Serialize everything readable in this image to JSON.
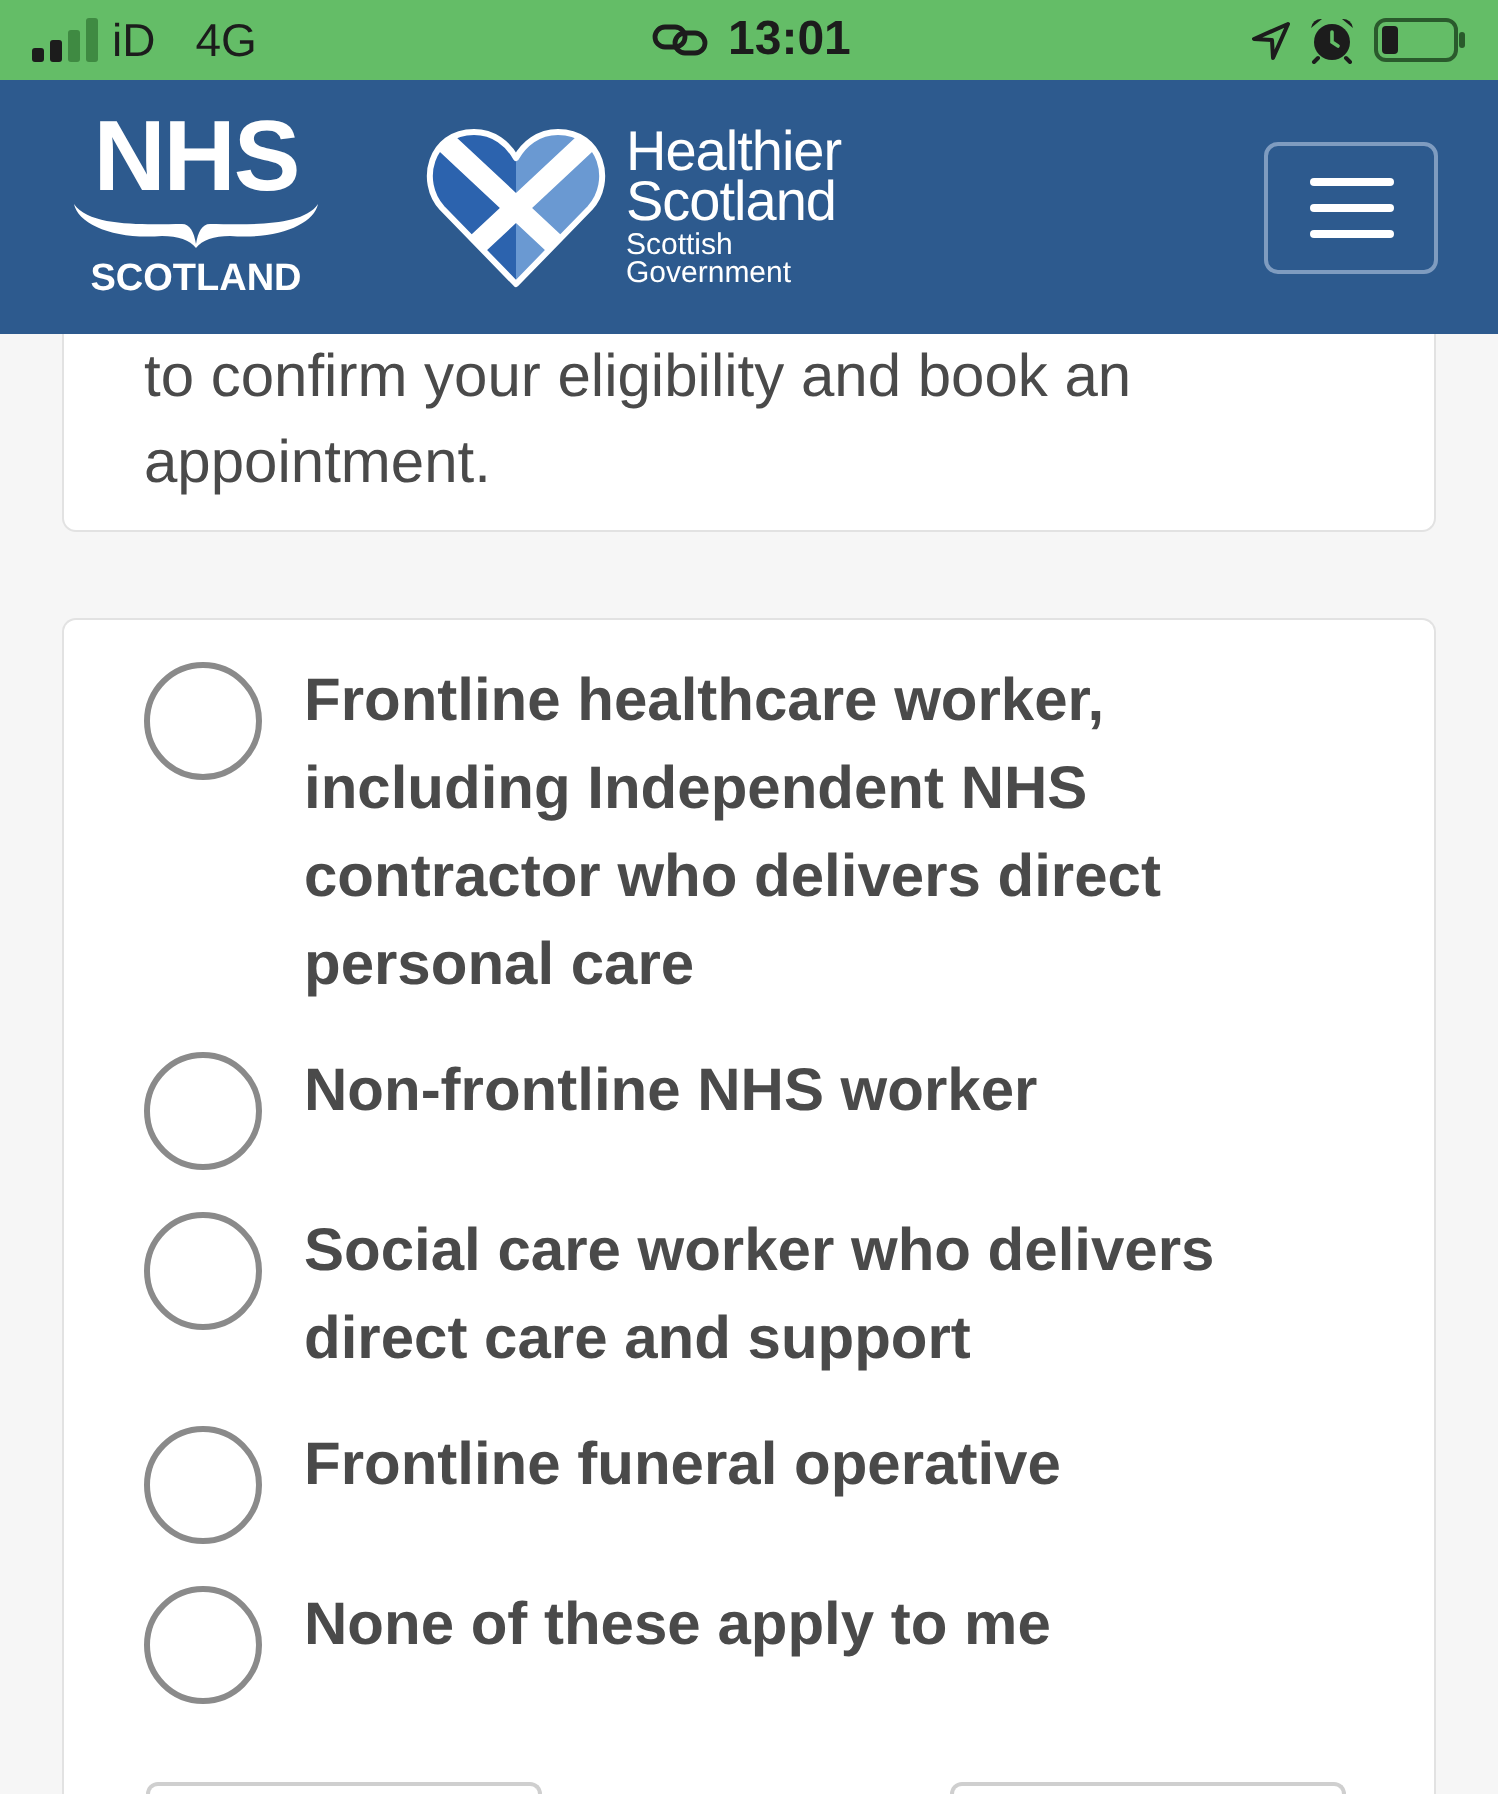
{
  "status_bar": {
    "carrier": "iD",
    "network": "4G",
    "time": "13:01"
  },
  "header": {
    "nhs_logo": {
      "title": "NHS",
      "subtitle": "SCOTLAND"
    },
    "partner_logo": {
      "title": "Healthier Scotland",
      "subtitle": "Scottish Government"
    }
  },
  "intro_card": {
    "text": "to confirm your eligibility and book an appointment."
  },
  "options": [
    {
      "label": "Frontline healthcare worker, including Independent NHS contractor who delivers direct personal care",
      "selected": false
    },
    {
      "label": "Non-frontline NHS worker",
      "selected": false
    },
    {
      "label": "Social care worker who delivers direct care and support",
      "selected": false
    },
    {
      "label": "Frontline funeral operative",
      "selected": false
    },
    {
      "label": "None of these apply to me",
      "selected": false
    }
  ]
}
